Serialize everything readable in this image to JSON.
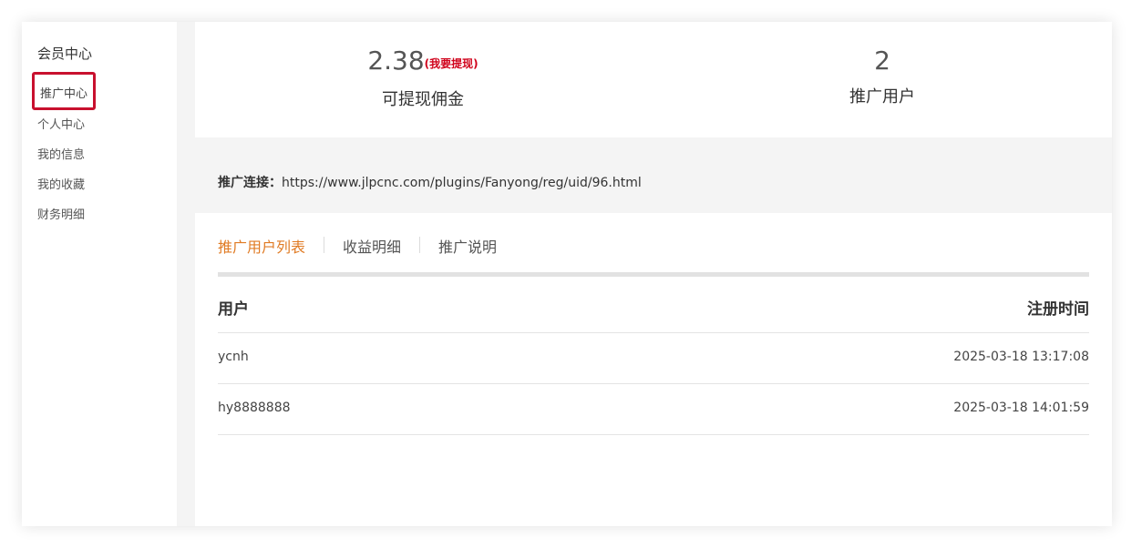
{
  "sidebar": {
    "title": "会员中心",
    "items": [
      {
        "label": "推广中心",
        "active": true
      },
      {
        "label": "个人中心"
      },
      {
        "label": "我的信息"
      },
      {
        "label": "我的收藏"
      },
      {
        "label": "财务明细"
      }
    ]
  },
  "stats": {
    "commission": {
      "value": "2.38",
      "link": "(我要提现)",
      "label": "可提现佣金"
    },
    "users": {
      "value": "2",
      "label": "推广用户"
    }
  },
  "promo": {
    "label": "推广连接：",
    "url": "https://www.jlpcnc.com/plugins/Fanyong/reg/uid/96.html"
  },
  "tabs": [
    {
      "label": "推广用户列表",
      "active": true
    },
    {
      "label": "收益明细"
    },
    {
      "label": "推广说明"
    }
  ],
  "table": {
    "headers": {
      "user": "用户",
      "time": "注册时间"
    },
    "rows": [
      {
        "user": "ycnh",
        "time": "2025-03-18 13:17:08"
      },
      {
        "user": "hy8888888",
        "time": "2025-03-18 14:01:59"
      }
    ]
  },
  "colors": {
    "accent_tab": "#e07b24",
    "withdraw_link": "#d0021b",
    "highlight_border": "#c8102e"
  }
}
